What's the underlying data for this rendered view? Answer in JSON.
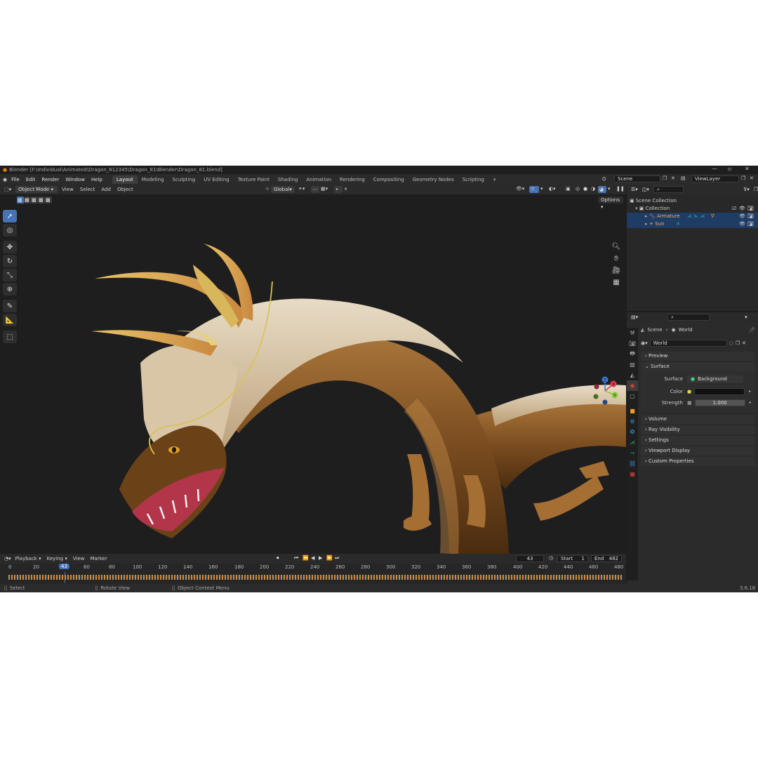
{
  "window": {
    "title": "Blender [F:\\Individual\\Animated\\Dragon_812345\\Dragon_81\\Blender\\Dragon_81.blend]"
  },
  "menu": {
    "items": [
      "File",
      "Edit",
      "Render",
      "Window",
      "Help"
    ]
  },
  "workspaces": [
    "Layout",
    "Modeling",
    "Sculpting",
    "UV Editing",
    "Texture Paint",
    "Shading",
    "Animation",
    "Rendering",
    "Compositing",
    "Geometry Nodes",
    "Scripting",
    "+"
  ],
  "scene": {
    "name": "Scene",
    "view_layer": "ViewLayer"
  },
  "viewport": {
    "mode": "Object Mode",
    "menus": [
      "View",
      "Select",
      "Add",
      "Object"
    ],
    "transform_orientation": "Global",
    "options_label": "Options",
    "gizmo_axes": [
      "Z",
      "X",
      "Y"
    ]
  },
  "timeline": {
    "menus": [
      "Playback",
      "Keying",
      "View",
      "Marker"
    ],
    "current_frame": "43",
    "start_label": "Start",
    "start": "1",
    "end_label": "End",
    "end": "482",
    "ticks": [
      "0",
      "20",
      "43",
      "60",
      "80",
      "100",
      "120",
      "140",
      "160",
      "180",
      "200",
      "220",
      "240",
      "260",
      "280",
      "300",
      "320",
      "340",
      "360",
      "380",
      "400",
      "420",
      "440",
      "460",
      "480"
    ]
  },
  "status": {
    "select": "Select",
    "rotate": "Rotate View",
    "context": "Object Context Menu",
    "version": "3.6.18"
  },
  "outliner": {
    "root": "Scene Collection",
    "collection": "Collection",
    "items": [
      "Armature",
      "Sun"
    ]
  },
  "properties": {
    "breadcrumb": [
      "Scene",
      "World"
    ],
    "world_name": "World",
    "panels_top": [
      "Preview",
      "Surface"
    ],
    "surface_label": "Surface",
    "surface_value": "Background",
    "color_label": "Color",
    "strength_label": "Strength",
    "strength_value": "1.000",
    "panels_bottom": [
      "Volume",
      "Ray Visibility",
      "Settings",
      "Viewport Display",
      "Custom Properties"
    ]
  },
  "colors": {
    "accent": "#4772b3",
    "selection": "#1f3c64",
    "playhead": "#4772b3",
    "x_axis": "#e8394f",
    "y_axis": "#8cc63f",
    "z_axis": "#3c7ad8"
  }
}
